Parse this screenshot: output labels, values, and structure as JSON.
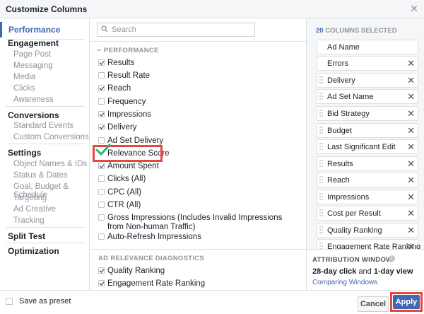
{
  "window": {
    "title": "Customize Columns"
  },
  "nav": {
    "active": "Performance",
    "sections": [
      {
        "label": "Engagement",
        "items": [
          "Page Post",
          "Messaging",
          "Media",
          "Clicks",
          "Awareness"
        ]
      },
      {
        "label": "Conversions",
        "items": [
          "Standard Events",
          "Custom Conversions"
        ]
      },
      {
        "label": "Settings",
        "items": [
          "Object Names & IDs",
          "Status & Dates",
          "Goal, Budget & Schedule",
          "Targeting",
          "Ad Creative",
          "Tracking"
        ]
      },
      {
        "label": "Split Test",
        "items": []
      },
      {
        "label": "Optimization",
        "items": []
      }
    ]
  },
  "search": {
    "placeholder": "Search",
    "value": ""
  },
  "performance": {
    "header": "PERFORMANCE",
    "items": [
      {
        "label": "Results",
        "checked": true
      },
      {
        "label": "Result Rate",
        "checked": false
      },
      {
        "label": "Reach",
        "checked": true
      },
      {
        "label": "Frequency",
        "checked": false
      },
      {
        "label": "Impressions",
        "checked": true
      },
      {
        "label": "Delivery",
        "checked": true
      },
      {
        "label": "Ad Set Delivery",
        "checked": false
      },
      {
        "label": "Relevance Score",
        "checked": true
      },
      {
        "label": "Amount Spent",
        "checked": true
      },
      {
        "label": "Clicks (All)",
        "checked": false
      },
      {
        "label": "CPC (All)",
        "checked": false
      },
      {
        "label": "CTR (All)",
        "checked": false
      },
      {
        "label": "Gross Impressions (Includes Invalid Impressions",
        "label2": "from Non-human Traffic)",
        "checked": false
      },
      {
        "label": "Auto-Refresh Impressions",
        "checked": false
      }
    ]
  },
  "diagnostics": {
    "header": "AD RELEVANCE DIAGNOSTICS",
    "items": [
      {
        "label": "Quality Ranking",
        "checked": true
      },
      {
        "label": "Engagement Rate Ranking",
        "checked": true
      }
    ]
  },
  "selected": {
    "count": "20",
    "count_suffix": "COLUMNS SELECTED",
    "items": [
      {
        "label": "Ad Name",
        "fixed": true
      },
      {
        "label": "Errors",
        "fixed": true
      },
      {
        "label": "Delivery",
        "fixed": false
      },
      {
        "label": "Ad Set Name",
        "fixed": false
      },
      {
        "label": "Bid Strategy",
        "fixed": false
      },
      {
        "label": "Budget",
        "fixed": false
      },
      {
        "label": "Last Significant Edit",
        "fixed": false
      },
      {
        "label": "Results",
        "fixed": false
      },
      {
        "label": "Reach",
        "fixed": false
      },
      {
        "label": "Impressions",
        "fixed": false
      },
      {
        "label": "Cost per Result",
        "fixed": false
      },
      {
        "label": "Quality Ranking",
        "fixed": false
      },
      {
        "label": "Engagement Rate Ranking",
        "fixed": false
      }
    ]
  },
  "attribution": {
    "header": "ATTRIBUTION WINDOW",
    "click": "28-day click",
    "and": "and",
    "view": "1-day view",
    "link": "Comparing Windows"
  },
  "footer": {
    "preset_label": "Save as preset",
    "cancel_label": "Cancel",
    "apply_label": "Apply"
  },
  "colors": {
    "accent": "#4267b2",
    "highlight": "#e5483f",
    "check_green": "#2db36f"
  }
}
